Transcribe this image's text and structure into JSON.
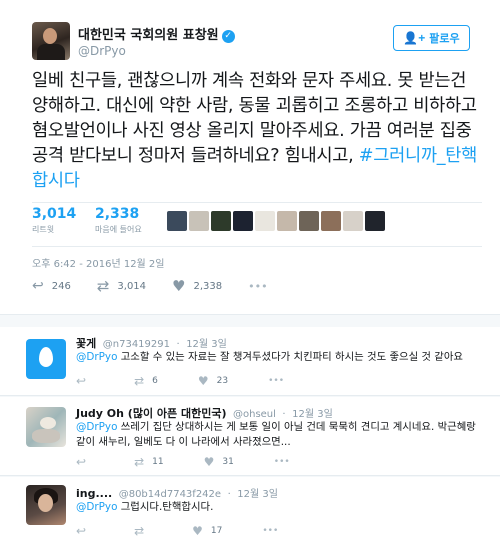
{
  "tweet": {
    "name": "대한민국 국회의원 표창원",
    "verified_icon": "verified-badge-icon",
    "handle": "@DrPyo",
    "follow_label": "팔로우",
    "text_main": "일베 친구들, 괜찮으니까 계속 전화와 문자 주세요. 못 받는건 양해하고. 대신에 약한 사람, 동물 괴롭히고 조롱하고 비하하고 혐오발언이나 사진 영상 올리지 말아주세요. 가끔 여러분 집중공격 받다보니 정마저 들려하네요? 힘내시고, ",
    "hashtag": "#그러니까_탄핵합시다",
    "retweets_count": "3,014",
    "retweets_label": "리트윗",
    "likes_count": "2,338",
    "likes_label": "마음에 들어요",
    "liker_colors": [
      "#3b4a5c",
      "#c8c2b8",
      "#2d3a2a",
      "#1c2230",
      "#e9e6df",
      "#c5b8aa",
      "#6e6458",
      "#8c6f5a",
      "#d7d1c9",
      "#20242c"
    ],
    "timestamp": "오후 6:42 - 2016년 12월 2일",
    "actions": {
      "reply_count": "246",
      "retweet_count": "3,014",
      "like_count": "2,338",
      "more": "•••"
    }
  },
  "replies": [
    {
      "name": "꽃게",
      "handle": "@n73419291",
      "date": "12월 3일",
      "mention": "@DrPyo",
      "text": " 고소할 수 있는 자료는 잘 챙겨두셨다가 치킨파티 하시는 것도 좋으실 것 같아요",
      "retweets": "6",
      "likes": "23",
      "more": "•••"
    },
    {
      "name": "Judy Oh (많이 아픈 대한민국)",
      "handle": "@ohseul",
      "date": "12월 3일",
      "mention": "@DrPyo",
      "text": " 쓰레기 집단 상대하시는 게 보통 일이 아닐 건데 묵묵히 견디고 계시네요. 박근혜랑 같이 새누리, 일베도 다 이 나라에서 사라졌으면...",
      "retweets": "11",
      "likes": "31",
      "more": "•••"
    },
    {
      "name": "ing....",
      "handle": "@80b14d7743f242e",
      "date": "12월 3일",
      "mention": "@DrPyo",
      "text": " 그럽시다.탄핵합시다.",
      "retweets": "",
      "likes": "17",
      "more": "•••"
    }
  ]
}
